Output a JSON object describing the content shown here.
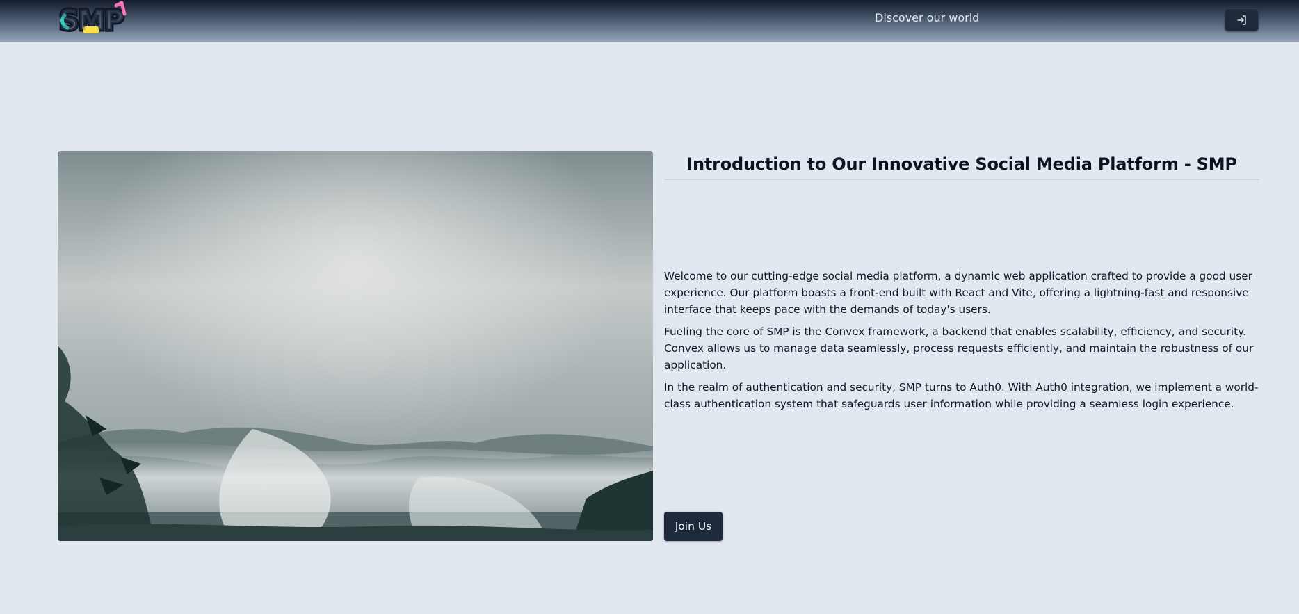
{
  "header": {
    "logo_text": "SMP",
    "nav_link": "Discover our world",
    "login_icon": "login-arrow-icon"
  },
  "main": {
    "title": "Introduction to Our Innovative Social Media Platform - SMP",
    "paragraphs": [
      "Welcome to our cutting-edge social media platform, a dynamic web application crafted to provide a good user experience. Our platform boasts a front-end built with React and Vite, offering a lightning-fast and responsive interface that keeps pace with the demands of today's users.",
      "Fueling the core of SMP is the Convex framework, a backend that enables scalability, efficiency, and security. Convex allows us to manage data seamlessly, process requests efficiently, and maintain the robustness of our application.",
      "In the realm of authentication and security, SMP turns to Auth0. With Auth0 integration, we implement a world-class authentication system that safeguards user information while providing a seamless login experience."
    ],
    "cta_label": "Join Us"
  },
  "colors": {
    "background": "#e2e8f0",
    "button": "#1e293b",
    "navbar_top": "#141b2b"
  }
}
